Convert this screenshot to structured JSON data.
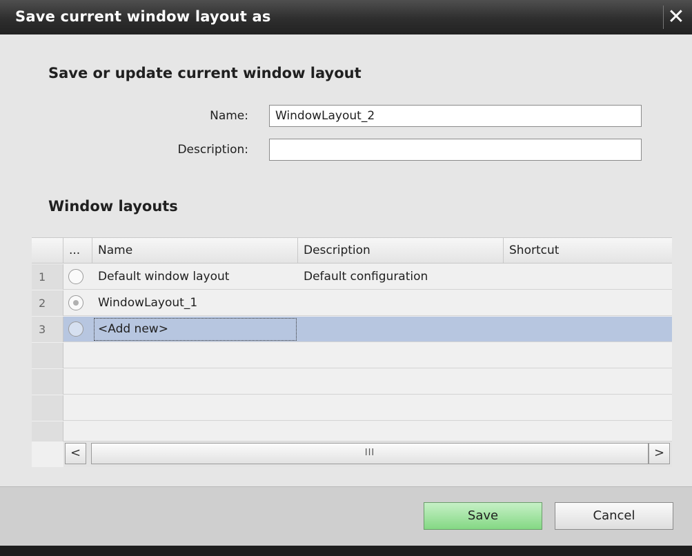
{
  "dialog": {
    "title": "Save current window layout as",
    "close_icon": "close-icon"
  },
  "form": {
    "heading": "Save or update current window layout",
    "name_label": "Name:",
    "name_value": "WindowLayout_2",
    "description_label": "Description:",
    "description_value": ""
  },
  "layouts": {
    "heading": "Window layouts",
    "columns": [
      "...",
      "Name",
      "Description",
      "Shortcut"
    ],
    "rows": [
      {
        "num": "1",
        "name": "Default window layout",
        "description": "Default configuration",
        "shortcut": "",
        "selected": false
      },
      {
        "num": "2",
        "name": "WindowLayout_1",
        "description": "",
        "shortcut": "",
        "selected": false
      },
      {
        "num": "3",
        "name": "<Add new>",
        "description": "",
        "shortcut": "",
        "selected": true
      }
    ],
    "scroll_left": "<",
    "scroll_right": ">",
    "scroll_grip": "III"
  },
  "buttons": {
    "save": "Save",
    "cancel": "Cancel"
  },
  "colors": {
    "selection": "#b7c6e0",
    "save_button": "#9ee29e",
    "titlebar": "#333333"
  }
}
